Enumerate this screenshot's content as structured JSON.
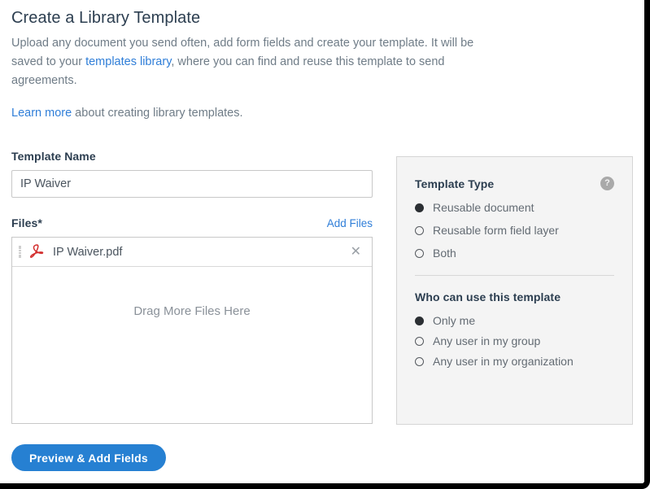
{
  "header": {
    "title": "Create a Library Template",
    "intro_part1": "Upload any document you send often, add form fields and create your template. It will be saved to your ",
    "intro_link": "templates library",
    "intro_part2": ", where you can find and reuse this template to send agreements.",
    "learn_more_link": "Learn more",
    "learn_more_rest": " about creating library templates."
  },
  "template_name": {
    "label": "Template Name",
    "value": "IP Waiver",
    "placeholder": ""
  },
  "files": {
    "label": "Files",
    "required_mark": "*",
    "add_files_label": "Add Files",
    "items": [
      {
        "name": "IP Waiver.pdf",
        "icon": "pdf-icon",
        "grip_icon": "drag-handle-icon",
        "remove_icon": "✕"
      }
    ],
    "drop_text": "Drag More Files Here"
  },
  "template_type": {
    "title": "Template Type",
    "help_icon": "?",
    "options": [
      {
        "label": "Reusable document",
        "selected": true
      },
      {
        "label": "Reusable form field layer",
        "selected": false
      },
      {
        "label": "Both",
        "selected": false
      }
    ]
  },
  "visibility": {
    "title": "Who can use this template",
    "options": [
      {
        "label": "Only me",
        "selected": true
      },
      {
        "label": "Any user in my group",
        "selected": false
      },
      {
        "label": "Any user in my organization",
        "selected": false
      }
    ]
  },
  "footer": {
    "preview_button": "Preview & Add Fields"
  },
  "colors": {
    "accent": "#2680d2",
    "link": "#2f7ed8",
    "panel_bg": "#f4f4f4",
    "pdf_red": "#d32f2f",
    "heading": "#2c3e50"
  }
}
